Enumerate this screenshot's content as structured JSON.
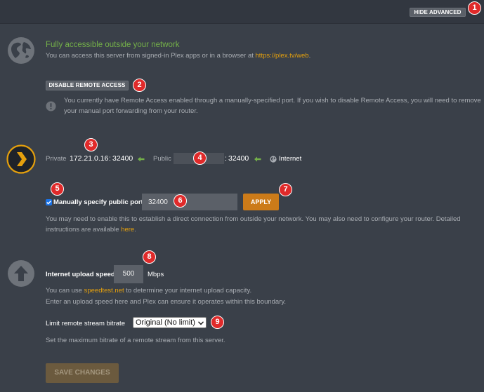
{
  "header": {
    "hide_advanced_label": "HIDE ADVANCED"
  },
  "status": {
    "title": "Fully accessible outside your network",
    "desc_prefix": "You can access this server from signed-in Plex apps or in a browser at ",
    "desc_link": "https://plex.tv/web",
    "desc_suffix": "."
  },
  "remote": {
    "disable_label": "DISABLE REMOTE ACCESS",
    "notice_line1": "You currently have Remote Access enabled through a manually-specified port. If you wish to disable Remote Access, you will need to remove",
    "notice_line2": "your manual port forwarding from your router."
  },
  "connection": {
    "private_label": "Private",
    "private_ip": "172.21.0.16",
    "private_sep": ":",
    "private_port": "32400",
    "public_label": "Public",
    "public_sep": ":",
    "public_port": "32400",
    "internet_label": "Internet"
  },
  "manual_port": {
    "checkbox_label": "Manually specify public port",
    "checked": true,
    "port_value": "32400",
    "apply_label": "APPLY",
    "help_line1": "You may need to enable this to establish a direct connection from outside your network. You may also need to configure your router. Detailed",
    "help_line2_prefix": "instructions are available ",
    "help_line2_link": "here",
    "help_line2_suffix": "."
  },
  "upload": {
    "label": "Internet upload speed",
    "value": "500",
    "unit": "Mbps",
    "help1_prefix": "You can use ",
    "help1_link": "speedtest.net",
    "help1_suffix": " to determine your internet upload capacity.",
    "help2": "Enter an upload speed here and Plex can ensure it operates within this boundary."
  },
  "bitrate": {
    "label": "Limit remote stream bitrate",
    "selected": "Original (No limit)",
    "help": "Set the maximum bitrate of a remote stream from this server."
  },
  "footer": {
    "save_label": "SAVE CHANGES"
  },
  "annotations": [
    "1",
    "2",
    "3",
    "4",
    "5",
    "6",
    "7",
    "8",
    "9"
  ],
  "colors": {
    "accent": "#e5a00d",
    "success": "#74b049",
    "badge": "#e02a2a",
    "apply": "#cc7b19"
  }
}
